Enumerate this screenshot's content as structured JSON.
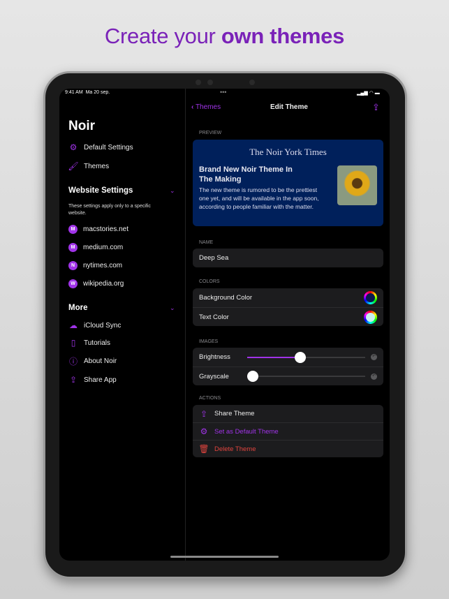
{
  "headline": {
    "regular": "Create your ",
    "bold": "own themes"
  },
  "status": {
    "time": "9:41 AM",
    "date": "Ma 20 sep."
  },
  "sidebar": {
    "title": "Noir",
    "top_items": [
      {
        "label": "Default Settings",
        "icon": "gear-icon"
      },
      {
        "label": "Themes",
        "icon": "paintbrush-icon"
      }
    ],
    "website_settings": {
      "title": "Website Settings",
      "description": "These settings apply only to a specific website.",
      "sites": [
        {
          "letter": "M",
          "label": "macstories.net"
        },
        {
          "letter": "M",
          "label": "medium.com"
        },
        {
          "letter": "N",
          "label": "nytimes.com"
        },
        {
          "letter": "W",
          "label": "wikipedia.org"
        }
      ]
    },
    "more": {
      "title": "More",
      "items": [
        {
          "label": "iCloud Sync",
          "icon": "cloud-icon"
        },
        {
          "label": "Tutorials",
          "icon": "book-icon"
        },
        {
          "label": "About Noir",
          "icon": "info-icon"
        },
        {
          "label": "Share App",
          "icon": "share-icon"
        }
      ]
    }
  },
  "nav": {
    "back": "Themes",
    "title": "Edit Theme"
  },
  "preview": {
    "label": "PREVIEW",
    "masthead": "The Noir York Times",
    "headline": "Brand New Noir Theme In The Making",
    "body": "The new theme is rumored to be the prettiest one yet, and will be available in the app soon, according to people familiar with the matter.",
    "background": "#00205b"
  },
  "name": {
    "label": "NAME",
    "value": "Deep Sea"
  },
  "colors": {
    "label": "COLORS",
    "background_label": "Background Color",
    "background_color": "#0a1a50",
    "text_label": "Text Color",
    "text_color": "#c8f0ee"
  },
  "images": {
    "label": "IMAGES",
    "brightness_label": "Brightness",
    "brightness": 0.45,
    "grayscale_label": "Grayscale",
    "grayscale": 0
  },
  "actions": {
    "label": "ACTIONS",
    "share": "Share Theme",
    "default": "Set as Default Theme",
    "delete": "Delete Theme"
  },
  "accent": "#a033e8",
  "danger": "#e0443e"
}
